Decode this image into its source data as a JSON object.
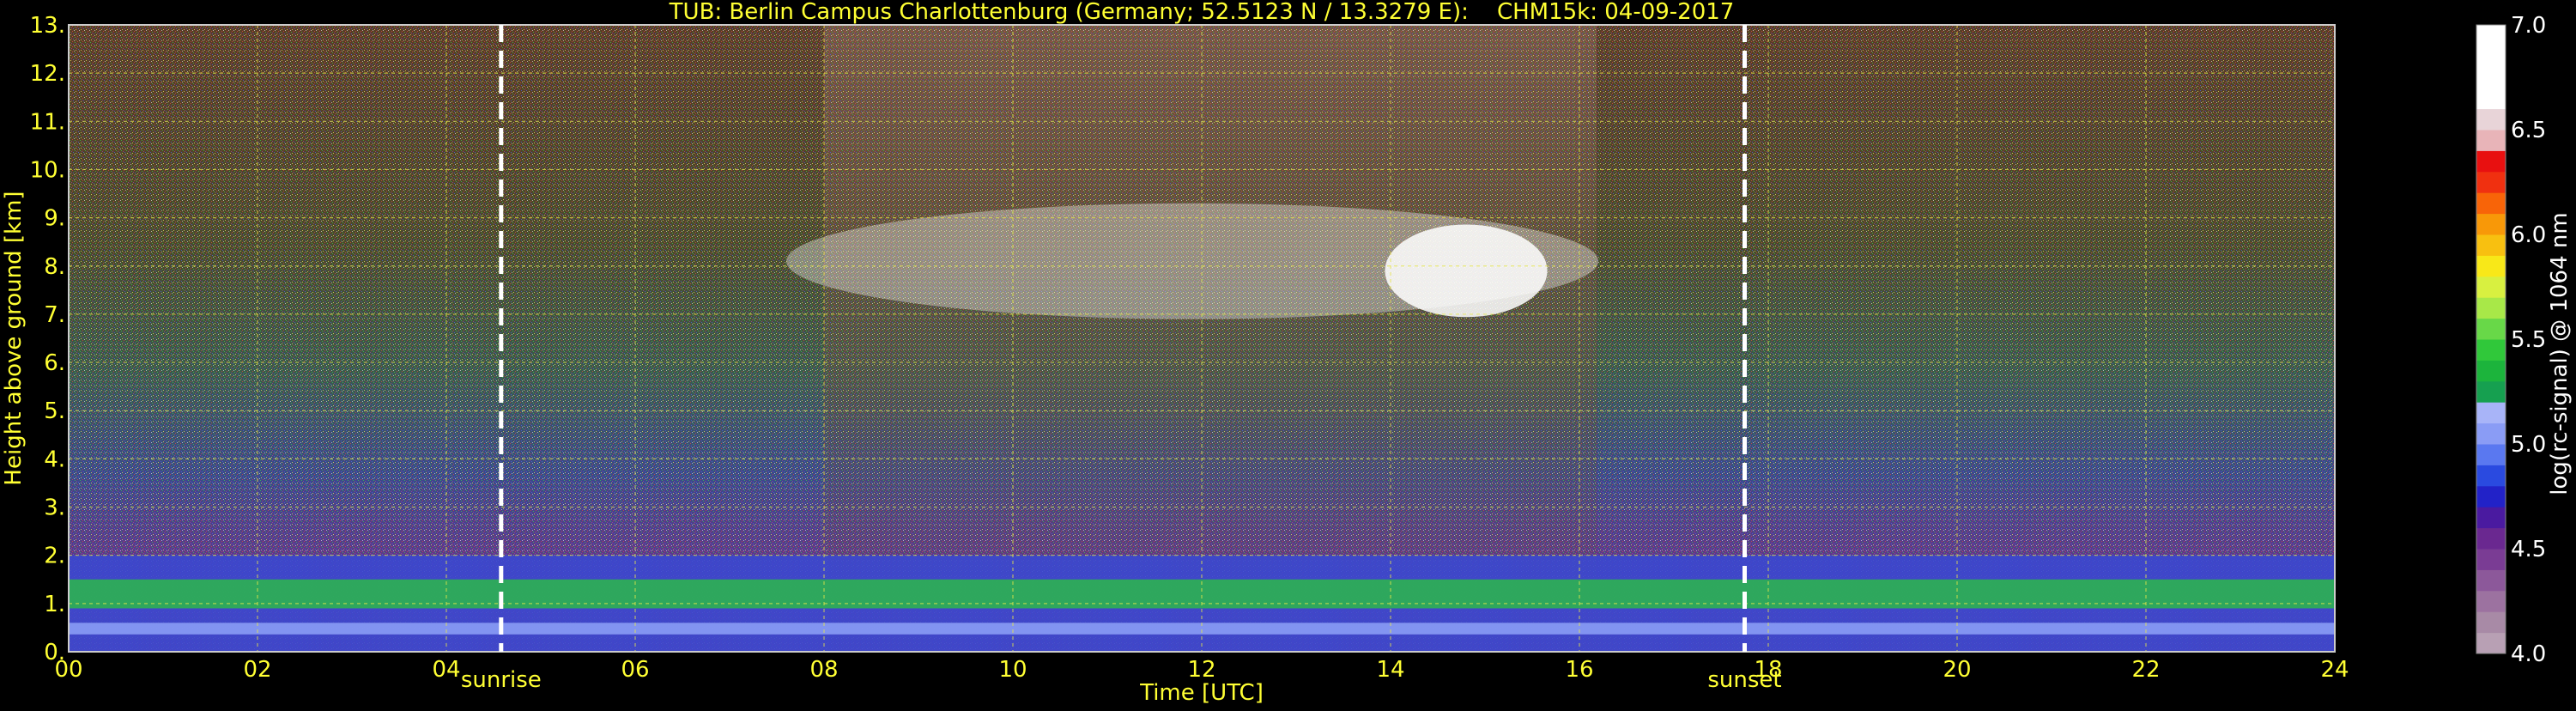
{
  "chart_data": {
    "type": "heatmap",
    "title": "TUB: Berlin Campus Charlottenburg (Germany; 52.5123 N / 13.3279 E):    CHM15k: 04-09-2017",
    "xlabel": "Time [UTC]",
    "ylabel": "Height above ground [km]",
    "xlim": [
      0,
      24
    ],
    "ylim": [
      0,
      13
    ],
    "x_ticks": [
      "00",
      "02",
      "04",
      "06",
      "08",
      "10",
      "12",
      "14",
      "16",
      "18",
      "20",
      "22",
      "24"
    ],
    "y_ticks": [
      "0.",
      "1.",
      "2.",
      "3.",
      "4.",
      "5.",
      "6.",
      "7.",
      "8.",
      "9.",
      "10.",
      "11.",
      "12.",
      "13."
    ],
    "grid": true,
    "markers": [
      {
        "label": "sunrise",
        "time": 4.58
      },
      {
        "label": "sunset",
        "time": 17.75
      }
    ],
    "colorbar": {
      "label": "log(rc-signal) @ 1064 nm",
      "range": [
        4.0,
        7.0
      ],
      "ticks": [
        "4.0",
        "4.5",
        "5.0",
        "5.5",
        "6.0",
        "6.5",
        "7.0"
      ],
      "colors": [
        "#b8a0b4",
        "#a88aa6",
        "#9c72a0",
        "#8c589a",
        "#7a3c94",
        "#6a2890",
        "#4a1aa0",
        "#2222c8",
        "#2a4ae0",
        "#5a78f0",
        "#8a9cf5",
        "#a8b4f8",
        "#16a050",
        "#1cb43c",
        "#30c83a",
        "#68d848",
        "#a8e848",
        "#d8f040",
        "#f8e818",
        "#f8c010",
        "#f89808",
        "#f86408",
        "#f03010",
        "#e81010",
        "#e8b4b8",
        "#e8d4d8",
        "#ffffff",
        "#ffffff",
        "#ffffff",
        "#ffffff"
      ]
    },
    "features": [
      {
        "name": "boundary layer",
        "t_start": 0,
        "t_end": 24,
        "h_low_km": 0.0,
        "h_high_km": 2.0,
        "log_signal": 5.2
      },
      {
        "name": "cirrus cloud",
        "t_start": 7.6,
        "t_end": 16.2,
        "h_low_km": 6.9,
        "h_high_km": 9.3,
        "log_signal": 6.8
      }
    ]
  }
}
